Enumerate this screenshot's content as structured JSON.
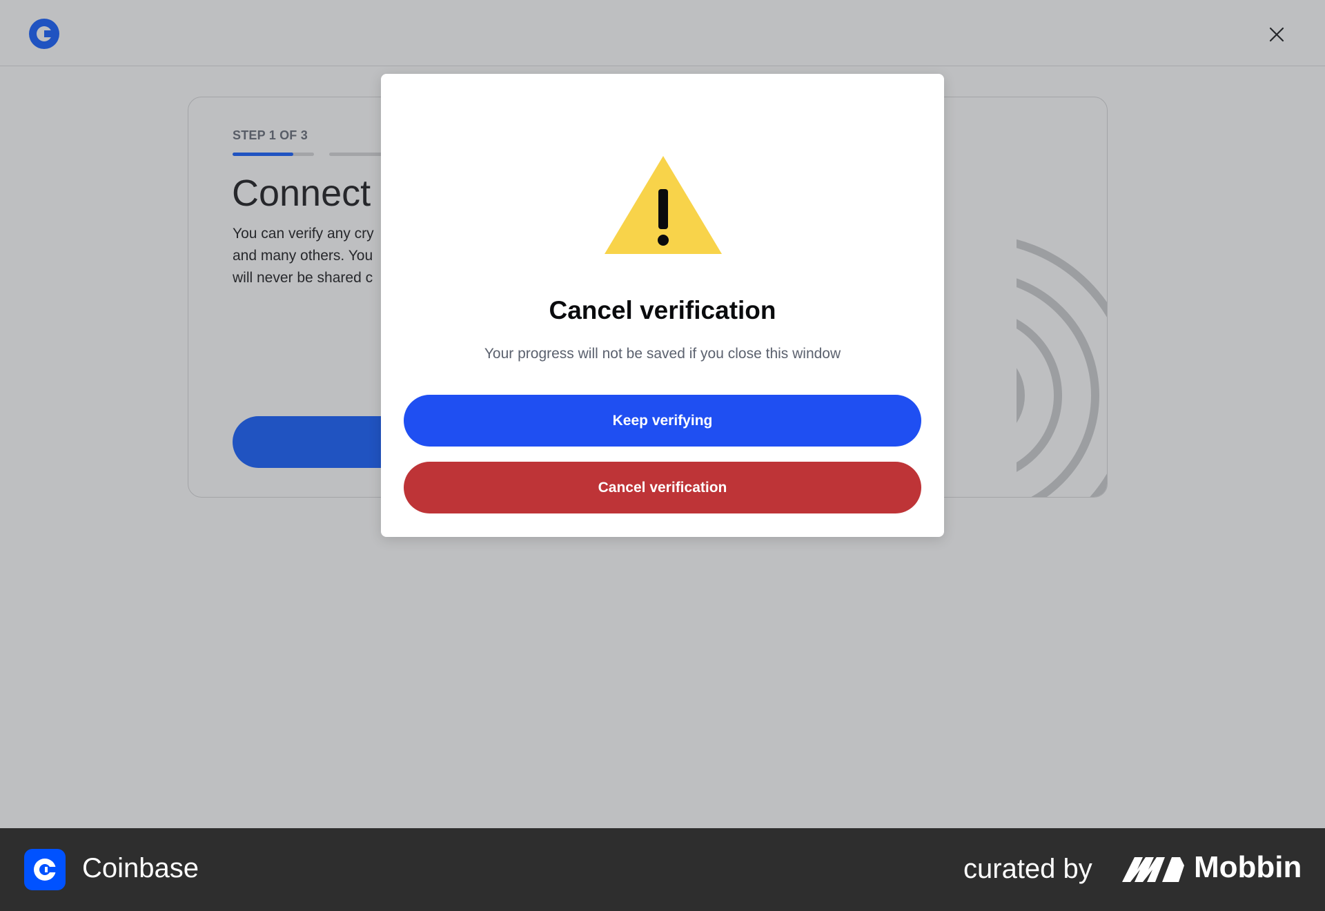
{
  "header": {
    "logo_icon": "coinbase-logo-icon",
    "close_icon": "close-icon"
  },
  "card": {
    "step_label": "STEP 1 OF 3",
    "progress": {
      "current_step": 1,
      "total_steps": 3,
      "first_step_fill": 0.75
    },
    "title": "Connect",
    "body_lines": [
      "You can verify any cry",
      "and many others. You",
      "will never be shared c"
    ]
  },
  "modal": {
    "icon": "warning-triangle-icon",
    "title": "Cancel verification",
    "subtitle": "Your progress will not be saved if you close this window",
    "primary_button": "Keep verifying",
    "danger_button": "Cancel verification"
  },
  "footer": {
    "brand": "Coinbase",
    "curated_by": "curated by",
    "curator": "Mobbin"
  },
  "colors": {
    "brand_blue": "#0052ff",
    "keep_button": "#1f4ff2",
    "cancel_button": "#be3437",
    "warning_yellow": "#f8d34a",
    "footer_bg": "#2e2e2e"
  }
}
